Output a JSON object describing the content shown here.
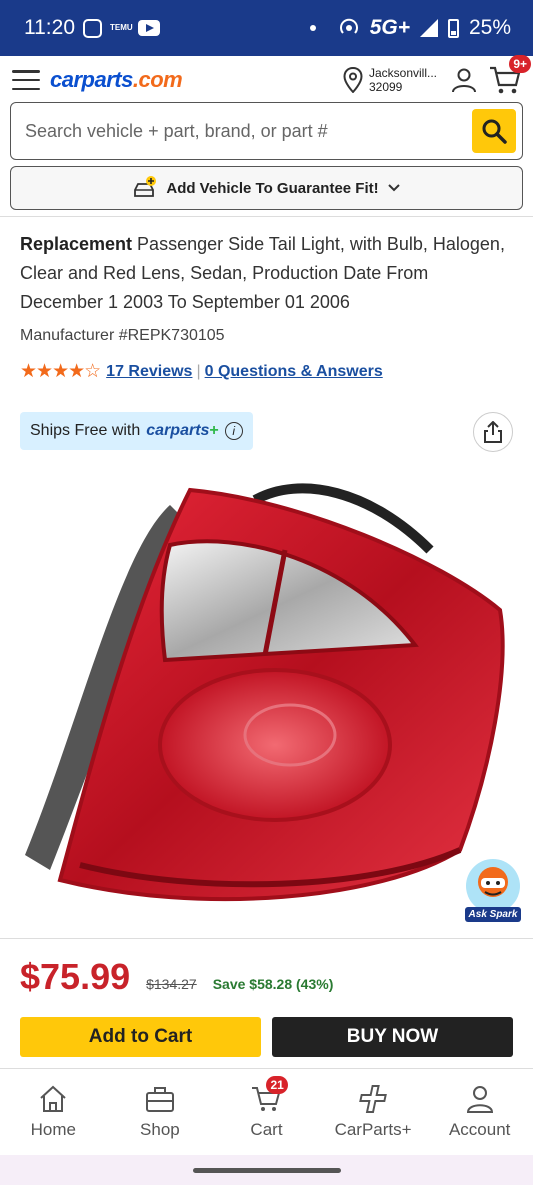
{
  "status_bar": {
    "time": "11:20",
    "temu_label": "TEMU",
    "network": "5G+",
    "battery": "25%"
  },
  "header": {
    "logo_main": "carparts",
    "logo_suffix": ".com",
    "location_city": "Jacksonvill...",
    "location_zip": "32099",
    "cart_badge": "9+"
  },
  "search": {
    "placeholder": "Search vehicle + part, brand, or part #"
  },
  "add_vehicle": {
    "label": "Add Vehicle To Guarantee Fit!"
  },
  "product": {
    "title_bold": "Replacement",
    "title_rest": " Passenger Side Tail Light, with Bulb, Halogen, Clear and Red Lens, Sedan, Production Date From December 1 2003 To September 01 2006",
    "manufacturer": "Manufacturer #REPK730105",
    "rating_value": 4.5,
    "stars": "★★★★☆",
    "reviews_link": "17 Reviews",
    "qa_link": "0 Questions & Answers",
    "ships_prefix": "Ships Free with",
    "ships_brand": "carparts",
    "ships_plus": "+",
    "ask_spark": "Ask Spark"
  },
  "pricing": {
    "current": "$75.99",
    "original": "$134.27",
    "savings": "Save $58.28 (43%)",
    "add_to_cart": "Add to Cart",
    "buy_now": "BUY NOW"
  },
  "tabbar": {
    "tabs": [
      {
        "label": "Home",
        "icon": "home-icon"
      },
      {
        "label": "Shop",
        "icon": "toolbox-icon"
      },
      {
        "label": "Cart",
        "icon": "cart-icon",
        "badge": "21"
      },
      {
        "label": "CarParts+",
        "icon": "carparts-plus-icon"
      },
      {
        "label": "Account",
        "icon": "account-icon"
      }
    ]
  },
  "colors": {
    "brand_blue": "#0a4fcf",
    "brand_orange": "#f26a1b",
    "cta_yellow": "#ffc80a",
    "price_red": "#c8232a",
    "save_green": "#2a7a32"
  }
}
